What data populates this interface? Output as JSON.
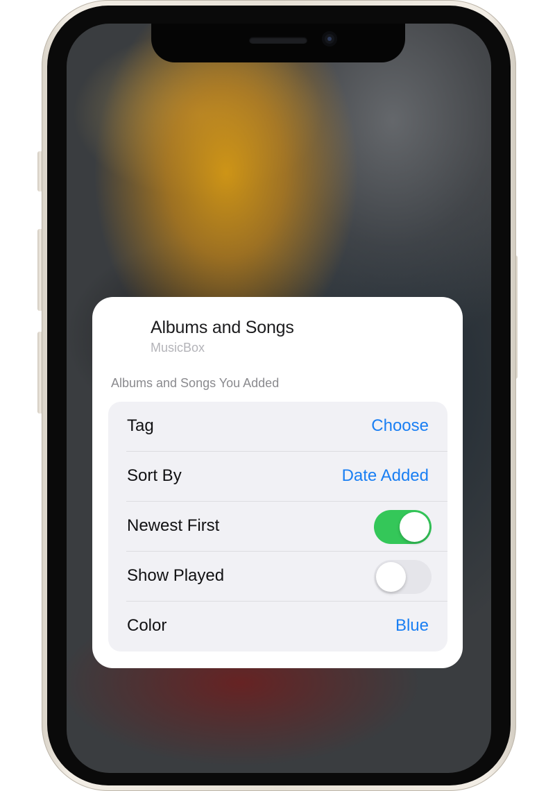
{
  "widget": {
    "title": "Albums and Songs",
    "app_name": "MusicBox",
    "section_header": "Albums and Songs You Added",
    "rows": [
      {
        "label": "Tag",
        "value": "Choose"
      },
      {
        "label": "Sort By",
        "value": "Date Added"
      },
      {
        "label": "Newest First",
        "toggle_on": true
      },
      {
        "label": "Show Played",
        "toggle_on": false
      },
      {
        "label": "Color",
        "value": "Blue"
      }
    ]
  },
  "colors": {
    "accent_blue": "#1a7ff3",
    "toggle_on_green": "#34c759",
    "toggle_off_gray": "#e5e5ea"
  }
}
